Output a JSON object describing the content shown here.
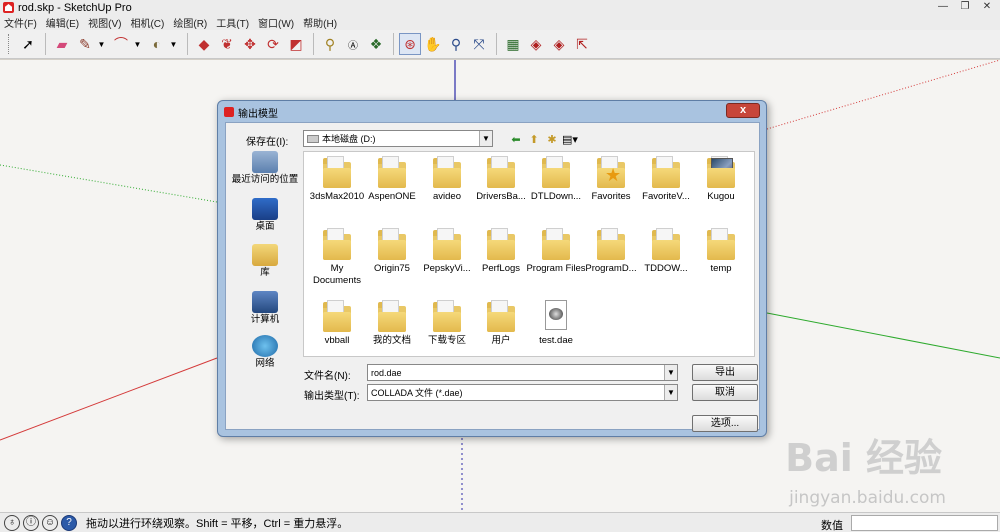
{
  "window": {
    "title": "rod.skp - SketchUp Pro",
    "minimize": "—",
    "maximize": "❐",
    "close": "✕"
  },
  "menu": [
    "文件(F)",
    "编辑(E)",
    "视图(V)",
    "相机(C)",
    "绘图(R)",
    "工具(T)",
    "窗口(W)",
    "帮助(H)"
  ],
  "colors": {
    "axis_red": "#d43a3a",
    "axis_green": "#2eaa2e",
    "axis_blue": "#2a2aa8",
    "dialog_frame": "#a9c3e0"
  },
  "dialog": {
    "title": "输出模型",
    "close": "x",
    "save_in_label": "保存在(I):",
    "location": "本地磁盘 (D:)",
    "places": [
      {
        "label": "最近访问的位置",
        "icon": "recent-places-icon"
      },
      {
        "label": "桌面",
        "icon": "desktop-icon"
      },
      {
        "label": "库",
        "icon": "libraries-icon"
      },
      {
        "label": "计算机",
        "icon": "computer-icon"
      },
      {
        "label": "网络",
        "icon": "network-icon"
      }
    ],
    "files": [
      {
        "name": "3dsMax2010",
        "kind": "folder"
      },
      {
        "name": "AspenONE",
        "kind": "folder"
      },
      {
        "name": "avideo",
        "kind": "folder"
      },
      {
        "name": "DriversBa...",
        "kind": "folder"
      },
      {
        "name": "DTLDown...",
        "kind": "folder"
      },
      {
        "name": "Favorites",
        "kind": "folder-star"
      },
      {
        "name": "FavoriteV...",
        "kind": "folder"
      },
      {
        "name": "Kugou",
        "kind": "folder-image"
      },
      {
        "name": "My Documents",
        "kind": "folder"
      },
      {
        "name": "Origin75",
        "kind": "folder"
      },
      {
        "name": "PepskyVi...",
        "kind": "folder"
      },
      {
        "name": "PerfLogs",
        "kind": "folder"
      },
      {
        "name": "Program Files",
        "kind": "folder"
      },
      {
        "name": "ProgramD...",
        "kind": "folder"
      },
      {
        "name": "TDDOW...",
        "kind": "folder"
      },
      {
        "name": "temp",
        "kind": "folder"
      },
      {
        "name": "vbball",
        "kind": "folder"
      },
      {
        "name": "我的文档",
        "kind": "folder"
      },
      {
        "name": "下载专区",
        "kind": "folder"
      },
      {
        "name": "用户",
        "kind": "folder"
      },
      {
        "name": "test.dae",
        "kind": "dae-file"
      }
    ],
    "filename_label": "文件名(N):",
    "filename_value": "rod.dae",
    "filetype_label": "输出类型(T):",
    "filetype_value": "COLLADA 文件 (*.dae)",
    "export_button": "导出",
    "cancel_button": "取消",
    "options_button": "选项..."
  },
  "status": {
    "message": "拖动以进行环绕观察。Shift = 平移，Ctrl = 重力悬浮。",
    "value_label": "数值"
  },
  "watermark": {
    "main": "Bai 经验",
    "sub": "jingyan.baidu.com"
  }
}
